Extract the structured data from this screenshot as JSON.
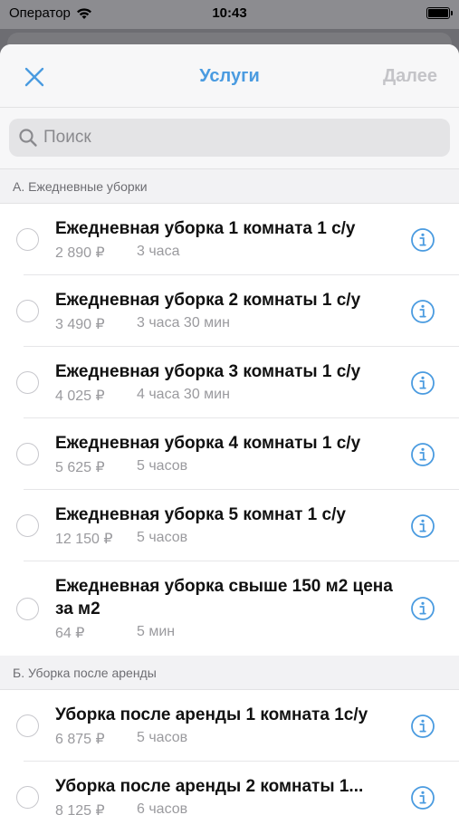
{
  "status": {
    "carrier": "Оператор",
    "time": "10:43"
  },
  "nav": {
    "title": "Услуги",
    "next_label": "Далее"
  },
  "search": {
    "placeholder": "Поиск"
  },
  "sections": [
    {
      "title": "А. Ежедневные уборки",
      "items": [
        {
          "title": "Ежедневная уборка 1 комната 1 с/у",
          "price": "2 890 ₽",
          "duration": "3 часа"
        },
        {
          "title": "Ежедневная уборка 2 комнаты 1 с/у",
          "price": "3 490 ₽",
          "duration": "3 часа 30 мин"
        },
        {
          "title": "Ежедневная уборка 3 комнаты 1 с/у",
          "price": "4 025 ₽",
          "duration": "4 часа 30 мин"
        },
        {
          "title": "Ежедневная уборка 4 комнаты 1 с/у",
          "price": "5 625 ₽",
          "duration": "5 часов"
        },
        {
          "title": "Ежедневная уборка 5 комнат 1 с/у",
          "price": "12 150 ₽",
          "duration": "5 часов"
        },
        {
          "title": "Ежедневная уборка свыше 150 м2 цена за м2",
          "price": "64 ₽",
          "duration": "5 мин"
        }
      ]
    },
    {
      "title": "Б. Уборка после аренды",
      "items": [
        {
          "title": "Уборка после аренды 1 комната 1с/у",
          "price": "6 875 ₽",
          "duration": "5 часов"
        },
        {
          "title": "Уборка после аренды 2 комнаты 1...",
          "price": "8 125 ₽",
          "duration": "6 часов"
        }
      ]
    }
  ]
}
